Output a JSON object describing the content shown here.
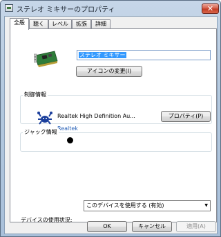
{
  "window": {
    "title": "ステレオ ミキサーのプロパティ",
    "close_glyph": "✕"
  },
  "tabs": [
    {
      "label": "全般",
      "active": true
    },
    {
      "label": "聴く",
      "active": false
    },
    {
      "label": "レベル",
      "active": false
    },
    {
      "label": "拡張",
      "active": false
    },
    {
      "label": "詳細",
      "active": false
    }
  ],
  "general": {
    "device_icon": "sound-card-icon",
    "name_value": "ステレオ ミキサー",
    "change_icon_button": "アイコンの変更(I)"
  },
  "controller": {
    "group_label": "制御情報",
    "icon": "realtek-crab-icon",
    "name": "Realtek High Definition Au...",
    "vendor": "Realtek",
    "properties_button": "プロパティ(P)"
  },
  "jack": {
    "group_label": "ジャック情報",
    "indicator_color": "#000000"
  },
  "usage": {
    "label": "デバイスの使用状況:",
    "selected": "このデバイスを使用する (有効)"
  },
  "footer": {
    "ok": "OK",
    "cancel": "キャンセル",
    "apply": "適用(A)"
  },
  "colors": {
    "selection": "#3399ff",
    "vendor_link": "#2a63b8",
    "close_button": "#c13a22"
  }
}
